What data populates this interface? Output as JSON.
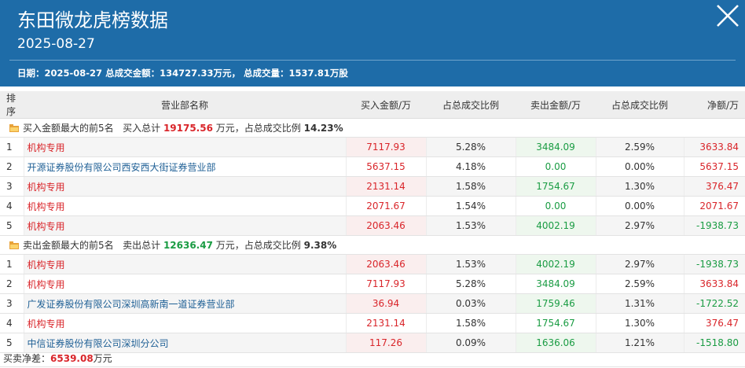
{
  "header": {
    "title": "东田微龙虎榜数据",
    "date": "2025-08-27",
    "summary_date_label": "日期：",
    "summary_date": "2025-08-27",
    "summary_turnover_label": "总成交金额：",
    "summary_turnover": "134727.33",
    "summary_turnover_unit": "万元，",
    "summary_volume_label": "总成交量：",
    "summary_volume": "1537.81",
    "summary_volume_unit": "万股",
    "close_icon": "close-icon"
  },
  "columns": [
    "排序",
    "营业部名称",
    "买入金额/万",
    "占总成交比例",
    "卖出金额/万",
    "占总成交比例",
    "净额/万"
  ],
  "buy_section": {
    "icon": "folder-icon",
    "label": "买入金额最大的前5名",
    "total_label": "买入总计",
    "total": "19175.56",
    "unit": "万元，占总成交比例",
    "ratio": "14.23%",
    "rows": [
      {
        "rank": "1",
        "name": "机构专用",
        "buy": "7117.93",
        "buy_pct": "5.28%",
        "sell": "3484.09",
        "sell_pct": "2.59%",
        "net": "3633.84"
      },
      {
        "rank": "2",
        "name": "开源证券股份有限公司西安西大街证券营业部",
        "buy": "5637.15",
        "buy_pct": "4.18%",
        "sell": "0.00",
        "sell_pct": "0.00%",
        "net": "5637.15"
      },
      {
        "rank": "3",
        "name": "机构专用",
        "buy": "2131.14",
        "buy_pct": "1.58%",
        "sell": "1754.67",
        "sell_pct": "1.30%",
        "net": "376.47"
      },
      {
        "rank": "4",
        "name": "机构专用",
        "buy": "2071.67",
        "buy_pct": "1.54%",
        "sell": "0.00",
        "sell_pct": "0.00%",
        "net": "2071.67"
      },
      {
        "rank": "5",
        "name": "机构专用",
        "buy": "2063.46",
        "buy_pct": "1.53%",
        "sell": "4002.19",
        "sell_pct": "2.97%",
        "net": "-1938.73"
      }
    ]
  },
  "sell_section": {
    "icon": "folder-icon",
    "label": "卖出金额最大的前5名",
    "total_label": "卖出总计",
    "total": "12636.47",
    "unit": "万元，占总成交比例",
    "ratio": "9.38%",
    "rows": [
      {
        "rank": "1",
        "name": "机构专用",
        "buy": "2063.46",
        "buy_pct": "1.53%",
        "sell": "4002.19",
        "sell_pct": "2.97%",
        "net": "-1938.73"
      },
      {
        "rank": "2",
        "name": "机构专用",
        "buy": "7117.93",
        "buy_pct": "5.28%",
        "sell": "3484.09",
        "sell_pct": "2.59%",
        "net": "3633.84"
      },
      {
        "rank": "3",
        "name": "广发证券股份有限公司深圳高新南一道证券营业部",
        "buy": "36.94",
        "buy_pct": "0.03%",
        "sell": "1759.46",
        "sell_pct": "1.31%",
        "net": "-1722.52"
      },
      {
        "rank": "4",
        "name": "机构专用",
        "buy": "2131.14",
        "buy_pct": "1.58%",
        "sell": "1754.67",
        "sell_pct": "1.30%",
        "net": "376.47"
      },
      {
        "rank": "5",
        "name": "中信证券股份有限公司深圳分公司",
        "buy": "117.26",
        "buy_pct": "0.09%",
        "sell": "1636.06",
        "sell_pct": "1.21%",
        "net": "-1518.80"
      }
    ]
  },
  "footer": {
    "label": "买卖净差：",
    "value": "6539.08",
    "unit": "万元"
  },
  "colors": {
    "header_bg": "#1e6ca8",
    "buy_red": "#d9252a",
    "sell_green": "#1a9c43",
    "link_blue": "#1e5f95"
  }
}
